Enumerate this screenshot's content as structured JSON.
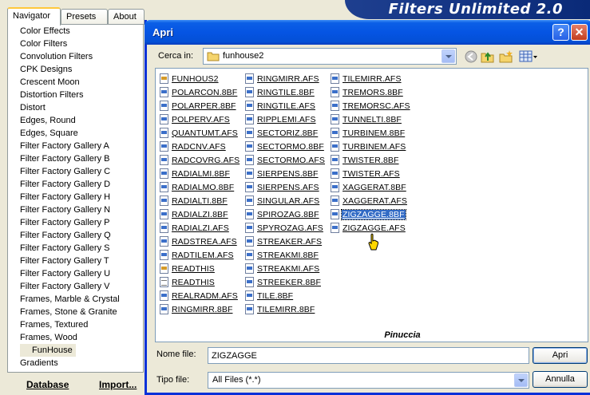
{
  "background_app": {
    "title": "Filters Unlimited 2.0",
    "tabs": [
      "Navigator",
      "Presets",
      "About"
    ],
    "active_tab": 0,
    "categories": [
      "Color Effects",
      "Color Filters",
      "Convolution Filters",
      "CPK Designs",
      "Crescent Moon",
      "Distortion Filters",
      "Distort",
      "Edges, Round",
      "Edges, Square",
      "Filter Factory Gallery A",
      "Filter Factory Gallery B",
      "Filter Factory Gallery C",
      "Filter Factory Gallery D",
      "Filter Factory Gallery H",
      "Filter Factory Gallery N",
      "Filter Factory Gallery P",
      "Filter Factory Gallery Q",
      "Filter Factory Gallery S",
      "Filter Factory Gallery T",
      "Filter Factory Gallery U",
      "Filter Factory Gallery V",
      "Frames, Marble & Crystal",
      "Frames, Stone & Granite",
      "Frames, Textured",
      "Frames, Wood",
      "FunHouse",
      "Gradients"
    ],
    "selected_category": "FunHouse",
    "buttons": {
      "database": "Database",
      "import": "Import..."
    }
  },
  "dialog": {
    "title": "Apri",
    "help_label": "?",
    "close_label": "✕",
    "look_in_label": "Cerca in:",
    "look_in_value": "funhouse2",
    "toolbar_icons": [
      "back-icon",
      "up-folder-icon",
      "new-folder-icon",
      "view-menu-icon"
    ],
    "files_col1": [
      {
        "name": "FUNHOUS2",
        "icon": "cfg"
      },
      {
        "name": "POLARCON.8BF",
        "icon": "plugin"
      },
      {
        "name": "POLARPER.8BF",
        "icon": "plugin"
      },
      {
        "name": "POLPERV.AFS",
        "icon": "plugin"
      },
      {
        "name": "QUANTUMT.AFS",
        "icon": "plugin"
      },
      {
        "name": "RADCNV.AFS",
        "icon": "plugin"
      },
      {
        "name": "RADCOVRG.AFS",
        "icon": "plugin"
      },
      {
        "name": "RADIALMI.8BF",
        "icon": "plugin"
      },
      {
        "name": "RADIALMO.8BF",
        "icon": "plugin"
      },
      {
        "name": "RADIALTI.8BF",
        "icon": "plugin"
      },
      {
        "name": "RADIALZI.8BF",
        "icon": "plugin"
      },
      {
        "name": "RADIALZI.AFS",
        "icon": "plugin"
      },
      {
        "name": "RADSTREA.AFS",
        "icon": "plugin"
      },
      {
        "name": "RADTILEM.AFS",
        "icon": "plugin"
      },
      {
        "name": "READTHIS",
        "icon": "cfg"
      },
      {
        "name": "READTHIS",
        "icon": "txt"
      },
      {
        "name": "REALRADM.AFS",
        "icon": "plugin"
      },
      {
        "name": "RINGMIRR.8BF",
        "icon": "plugin"
      }
    ],
    "files_col2": [
      {
        "name": "RINGMIRR.AFS",
        "icon": "plugin"
      },
      {
        "name": "RINGTILE.8BF",
        "icon": "plugin"
      },
      {
        "name": "RINGTILE.AFS",
        "icon": "plugin"
      },
      {
        "name": "RIPPLEMI.AFS",
        "icon": "plugin"
      },
      {
        "name": "SECTORIZ.8BF",
        "icon": "plugin"
      },
      {
        "name": "SECTORMO.8BF",
        "icon": "plugin"
      },
      {
        "name": "SECTORMO.AFS",
        "icon": "plugin"
      },
      {
        "name": "SIERPENS.8BF",
        "icon": "plugin"
      },
      {
        "name": "SIERPENS.AFS",
        "icon": "plugin"
      },
      {
        "name": "SINGULAR.AFS",
        "icon": "plugin"
      },
      {
        "name": "SPIROZAG.8BF",
        "icon": "plugin"
      },
      {
        "name": "SPYROZAG.AFS",
        "icon": "plugin"
      },
      {
        "name": "STREAKER.AFS",
        "icon": "plugin"
      },
      {
        "name": "STREAKMI.8BF",
        "icon": "plugin"
      },
      {
        "name": "STREAKMI.AFS",
        "icon": "plugin"
      },
      {
        "name": "STREEKER.8BF",
        "icon": "plugin"
      },
      {
        "name": "TILE.8BF",
        "icon": "plugin"
      },
      {
        "name": "TILEMIRR.8BF",
        "icon": "plugin"
      }
    ],
    "files_col3": [
      {
        "name": "TILEMIRR.AFS",
        "icon": "plugin"
      },
      {
        "name": "TREMORS.8BF",
        "icon": "plugin"
      },
      {
        "name": "TREMORSC.AFS",
        "icon": "plugin"
      },
      {
        "name": "TUNNELTI.8BF",
        "icon": "plugin"
      },
      {
        "name": "TURBINEM.8BF",
        "icon": "plugin"
      },
      {
        "name": "TURBINEM.AFS",
        "icon": "plugin"
      },
      {
        "name": "TWISTER.8BF",
        "icon": "plugin"
      },
      {
        "name": "TWISTER.AFS",
        "icon": "plugin"
      },
      {
        "name": "XAGGERAT.8BF",
        "icon": "plugin"
      },
      {
        "name": "XAGGERAT.AFS",
        "icon": "plugin"
      },
      {
        "name": "ZIGZAGGE.8BF",
        "icon": "plugin"
      },
      {
        "name": "ZIGZAGGE.AFS",
        "icon": "plugin"
      }
    ],
    "selected_file": "ZIGZAGGE.8BF",
    "watermark": "Pinuccia",
    "file_name_label": "Nome file:",
    "file_name_value": "ZIGZAGGE",
    "file_type_label": "Tipo file:",
    "file_type_value": "All Files (*.*)",
    "open_label": "Apri",
    "cancel_label": "Annulla"
  },
  "colors": {
    "titlebar": "#0554e3",
    "selection": "#316ac5",
    "banner": "#0a2a78"
  }
}
